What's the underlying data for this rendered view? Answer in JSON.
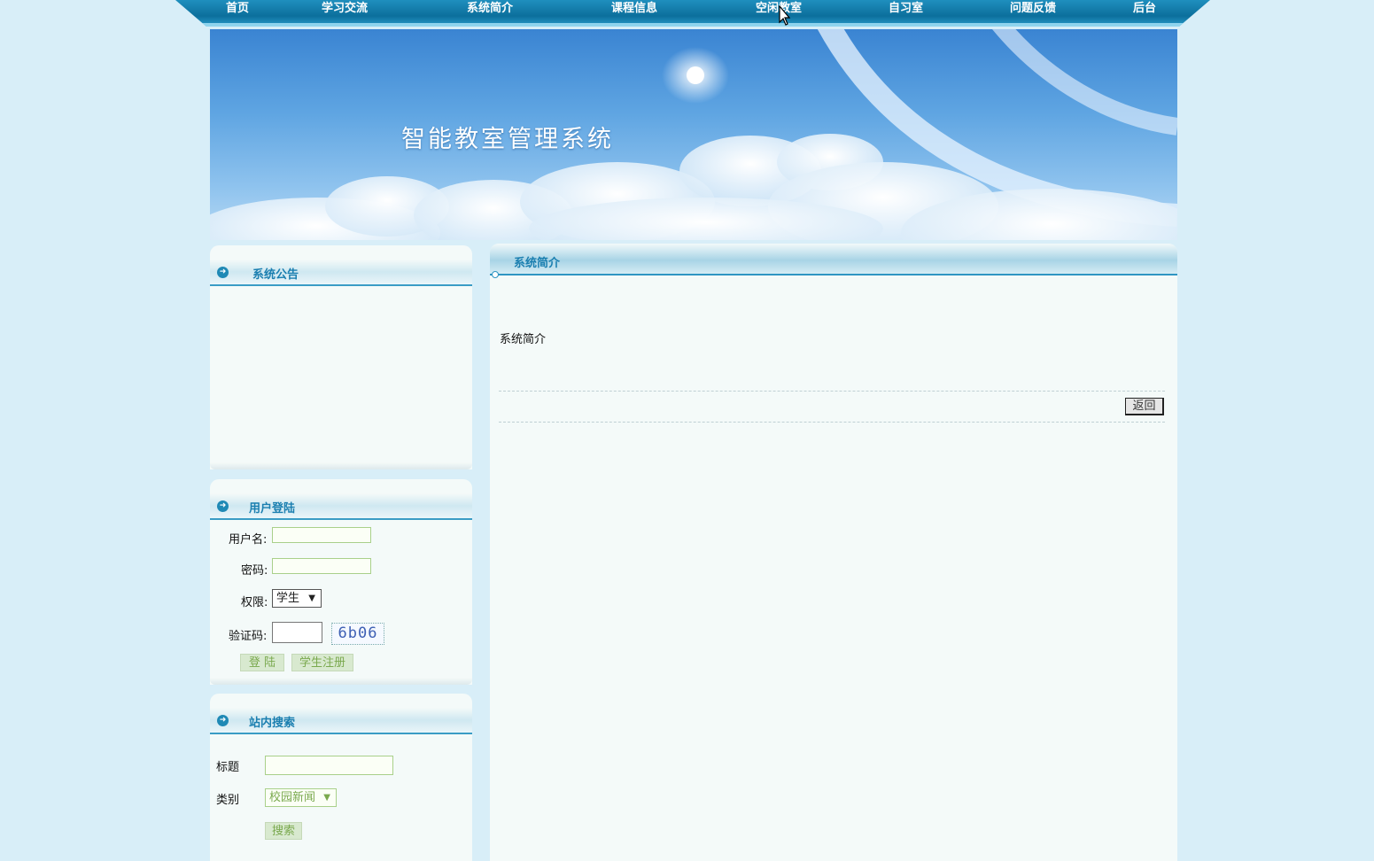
{
  "nav": {
    "items": [
      "首页",
      "学习交流",
      "系统简介",
      "课程信息",
      "空闲教室",
      "自习室",
      "问题反馈",
      "后台"
    ]
  },
  "banner": {
    "title": "智能教室管理系统"
  },
  "announcement": {
    "title": "系统公告"
  },
  "login": {
    "title": "用户登陆",
    "username_label": "用户名:",
    "username_value": "",
    "password_label": "密码:",
    "password_value": "",
    "role_label": "权限:",
    "role_selected": "学生",
    "captcha_label": "验证码:",
    "captcha_value": "",
    "captcha_image_text": "6b06",
    "login_button": "登 陆",
    "register_button": "学生注册"
  },
  "search": {
    "title": "站内搜索",
    "title_label": "标题",
    "title_value": "",
    "category_label": "类别",
    "category_selected": "校园新闻",
    "search_button": "搜索"
  },
  "main": {
    "title": "系统简介",
    "content": "系统简介",
    "back_button": "返回"
  },
  "colors": {
    "page_bg": "#d8eef8",
    "nav_bg": "#0c6f9c",
    "accent": "#1b7fb0",
    "panel_bg": "#f4faf9",
    "button_green": "#d8e9cf"
  }
}
